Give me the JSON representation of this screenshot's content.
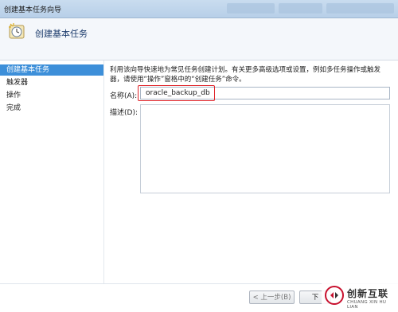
{
  "window": {
    "title": "创建基本任务向导"
  },
  "header": {
    "title": "创建基本任务",
    "icon": "clock-icon"
  },
  "sidebar": {
    "items": [
      {
        "label": "创建基本任务",
        "active": true
      },
      {
        "label": "触发器",
        "active": false
      },
      {
        "label": "操作",
        "active": false
      },
      {
        "label": "完成",
        "active": false
      }
    ]
  },
  "main": {
    "description": "利用该向导快速地为常见任务创建计划。有关更多高级选项或设置，例如多任务操作或触发器，请使用“操作”窗格中的“创建任务”命令。",
    "name_label": "名称(A):",
    "name_value": "oracle_backup_db",
    "description_label": "描述(D):",
    "description_value": ""
  },
  "footer": {
    "back_label": "< 上一步(B)",
    "next_label": "下"
  },
  "watermark": {
    "brand": "创新互联",
    "sub": "CHUANG XIN HU LIAN"
  },
  "colors": {
    "selection": "#3d8fd9",
    "highlight_border": "#e0242a",
    "header_text": "#1a3a6b"
  }
}
